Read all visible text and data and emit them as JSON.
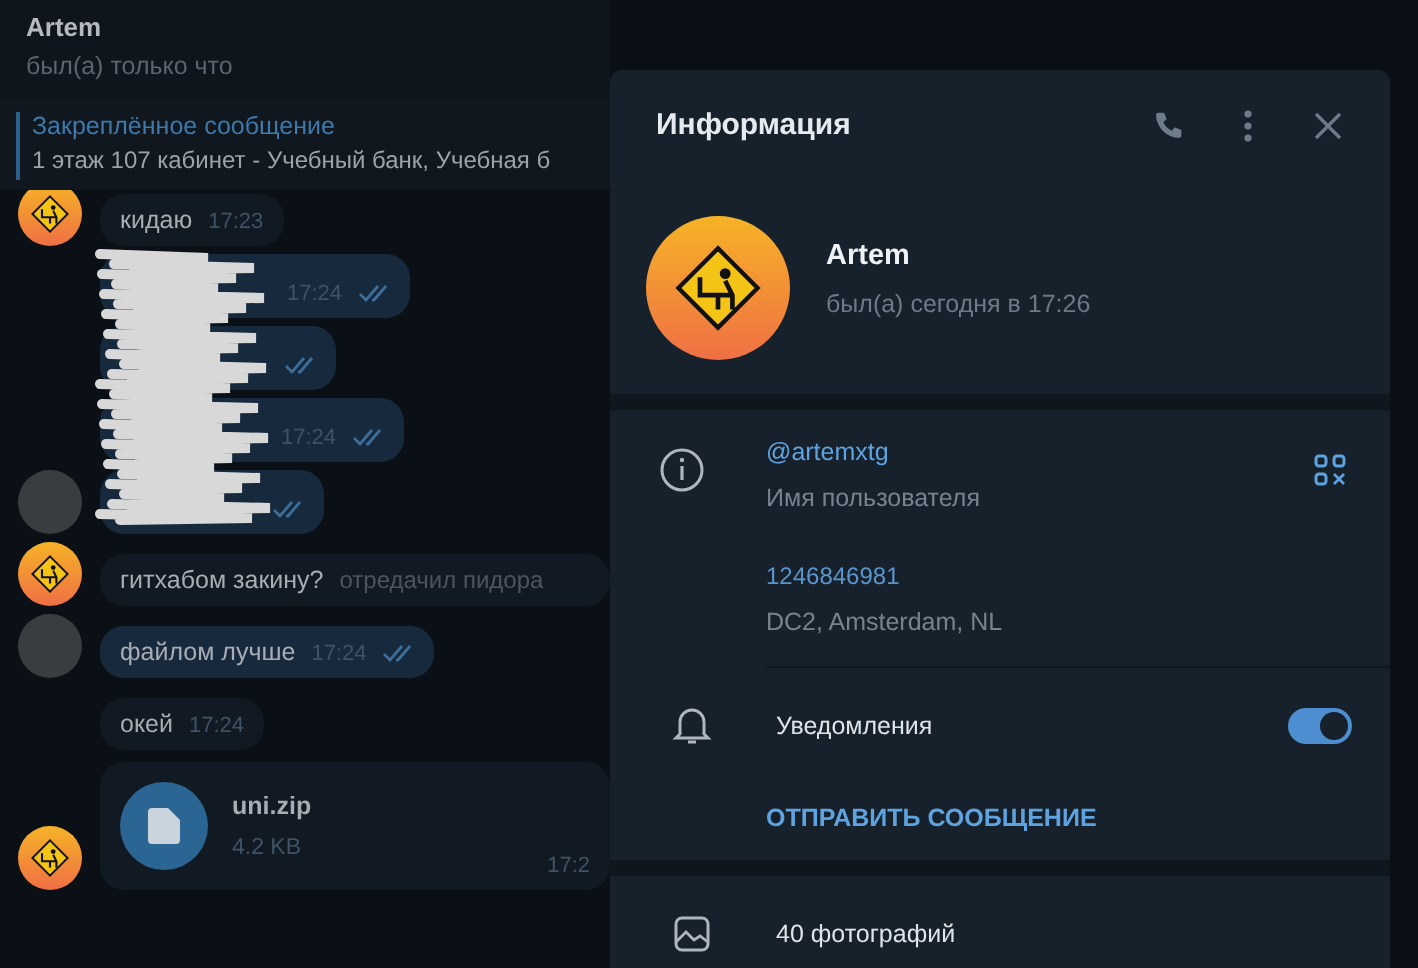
{
  "chat_header": {
    "name": "Artem",
    "status": "был(а) только что"
  },
  "pinned": {
    "title": "Закреплённое сообщение",
    "text": "1 этаж  107 кабинет - Учебный банк, Учебная б"
  },
  "messages": [
    {
      "kind": "text",
      "outgoing": false,
      "avatar": {
        "kind": "sign"
      },
      "text": "кидаю",
      "time": "17:23"
    },
    {
      "kind": "redacted",
      "outgoing": true,
      "time": "17:24"
    },
    {
      "kind": "redacted",
      "outgoing": true
    },
    {
      "kind": "redacted",
      "outgoing": true,
      "time": "17:24"
    },
    {
      "kind": "redacted",
      "outgoing": true,
      "avatar": {
        "kind": "photo"
      }
    },
    {
      "kind": "text",
      "outgoing": false,
      "avatar": {
        "kind": "sign"
      },
      "text": "гитхабом закину?",
      "note": "отредачил пидора"
    },
    {
      "kind": "text",
      "outgoing": true,
      "avatar": {
        "kind": "photo"
      },
      "text": "файлом лучше",
      "time": "17:24"
    },
    {
      "kind": "text",
      "outgoing": false,
      "text": "окей",
      "time": "17:24"
    },
    {
      "kind": "file",
      "outgoing": false,
      "avatar": {
        "kind": "sign"
      },
      "name": "uni.zip",
      "size": "4.2 KB",
      "time": "17:2"
    }
  ],
  "info_panel": {
    "title": "Информация",
    "profile": {
      "name": "Artem",
      "status": "был(а) сегодня в 17:26"
    },
    "username": {
      "value": "@artemxtg",
      "label": "Имя пользователя"
    },
    "id": {
      "value": "1246846981",
      "label": "DC2, Amsterdam, NL"
    },
    "notifications": {
      "label": "Уведомления",
      "on": true
    },
    "send_button": "ОТПРАВИТЬ СООБЩЕНИЕ",
    "media": [
      {
        "kind": "photos",
        "label": "40 фотографий"
      }
    ]
  }
}
